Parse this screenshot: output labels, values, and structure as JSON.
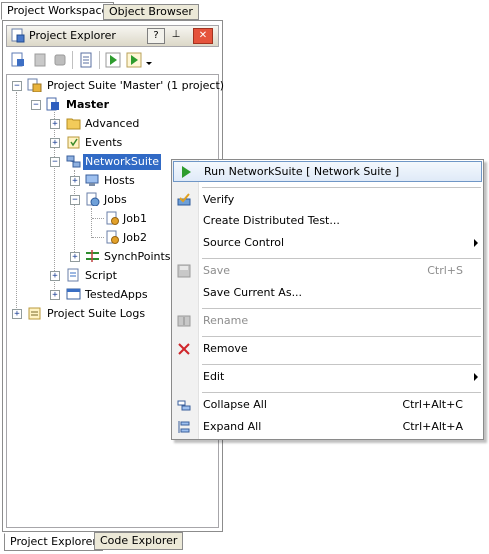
{
  "top_tabs": [
    "Project Workspace",
    "Object Browser"
  ],
  "explorer": {
    "title": "Project Explorer",
    "help_label": "?",
    "pin_label": "⊥",
    "close_label": "✕"
  },
  "tree": {
    "suite": "Project Suite 'Master' (1 project)",
    "project": "Master",
    "advanced": "Advanced",
    "events": "Events",
    "network_suite": "NetworkSuite",
    "hosts": "Hosts",
    "jobs": "Jobs",
    "job1": "Job1",
    "job2": "Job2",
    "synchpoints": "SynchPoints",
    "script": "Script",
    "testedapps": "TestedApps",
    "logs": "Project Suite Logs"
  },
  "context_menu": {
    "run": "Run NetworkSuite  [ Network Suite ]",
    "verify": "Verify",
    "create_distributed": "Create Distributed Test...",
    "source_control": "Source Control",
    "save": "Save",
    "save_shortcut": "Ctrl+S",
    "save_current_as": "Save Current As...",
    "rename": "Rename",
    "remove": "Remove",
    "edit": "Edit",
    "collapse_all": "Collapse All",
    "collapse_shortcut": "Ctrl+Alt+C",
    "expand_all": "Expand All",
    "expand_shortcut": "Ctrl+Alt+A"
  },
  "bottom_tabs": [
    "Project Explorer",
    "Code Explorer"
  ],
  "colors": {
    "selection": "#316ac5",
    "menu_highlight_border": "#6f96c6",
    "remove_icon": "#d0262b",
    "run_icon": "#2e9c2e"
  }
}
